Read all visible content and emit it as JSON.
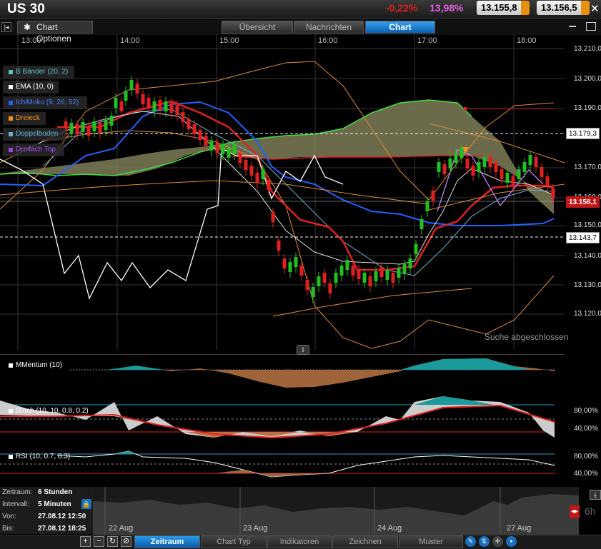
{
  "header": {
    "symbol": "US 30",
    "change_pct": "-0,22%",
    "volatility": "13,98%",
    "bid": "13.155,8",
    "ask": "13.156,5",
    "close_glyph": "✕"
  },
  "tabs": {
    "options_label": "Chart Optionen",
    "items": [
      {
        "label": "Übersicht"
      },
      {
        "label": "Nachrichten"
      },
      {
        "label": "Chart"
      }
    ],
    "active": "Chart"
  },
  "time_axis": [
    "13:00",
    "14:00",
    "15:00",
    "16:00",
    "17:00",
    "18:00"
  ],
  "price_axis": [
    "13.210,00",
    "13.200,00",
    "13.190,00",
    "13.179,3",
    "13.170,00",
    "13.160,00",
    "13.156,1",
    "13.150,00",
    "13.143,7",
    "13.140,00",
    "13.130,00",
    "13.120,00"
  ],
  "price_boxes": {
    "upper": "13.179,3",
    "current": "13.156,1",
    "lower": "13.143,7"
  },
  "legend": [
    {
      "label": "B Bänder (20, 2)",
      "color": "#60c0c0"
    },
    {
      "label": "EMA (10, 0)",
      "color": "#ffffff"
    },
    {
      "label": "IchiMoku (9, 26, 52)",
      "color": "#2060ff"
    },
    {
      "label": "Dreieck",
      "color": "#ff8c1a"
    },
    {
      "label": "Doppelboden",
      "color": "#60b0d0"
    },
    {
      "label": "Dreifach Top",
      "color": "#a040e0"
    }
  ],
  "status_text": "Suche abgeschlossen",
  "indicators": {
    "momentum": {
      "label": "MMentum (10)"
    },
    "stoch": {
      "label": "Stoch (10, 10, 0.8, 0.2)",
      "levels": [
        "80,00%",
        "40,00%"
      ]
    },
    "rsi": {
      "label": "RSI (10, 0.7, 0.3)",
      "levels": [
        "80,00%",
        "40,00%"
      ]
    }
  },
  "info_panel": [
    {
      "key": "Zeitraum:",
      "value": "6 Stunden"
    },
    {
      "key": "Intervall:",
      "value": "5 Minuten"
    },
    {
      "key": "Von:",
      "value": "27.08.12 12:50"
    },
    {
      "key": "Bis:",
      "value": "27.08.12 18:25"
    }
  ],
  "overview_dates": [
    "22 Aug",
    "23 Aug",
    "24 Aug",
    "27 Aug"
  ],
  "overview_range": "6h",
  "bottom_tabs": [
    {
      "label": "Zeitraum"
    },
    {
      "label": "Chart Typ"
    },
    {
      "label": "Indikatoren"
    },
    {
      "label": "Zeichnen"
    },
    {
      "label": "Muster"
    }
  ],
  "colors": {
    "down": "#e02020",
    "up": "#20c020",
    "accent": "#0a7ad0",
    "cloud": "#8a8a60"
  }
}
